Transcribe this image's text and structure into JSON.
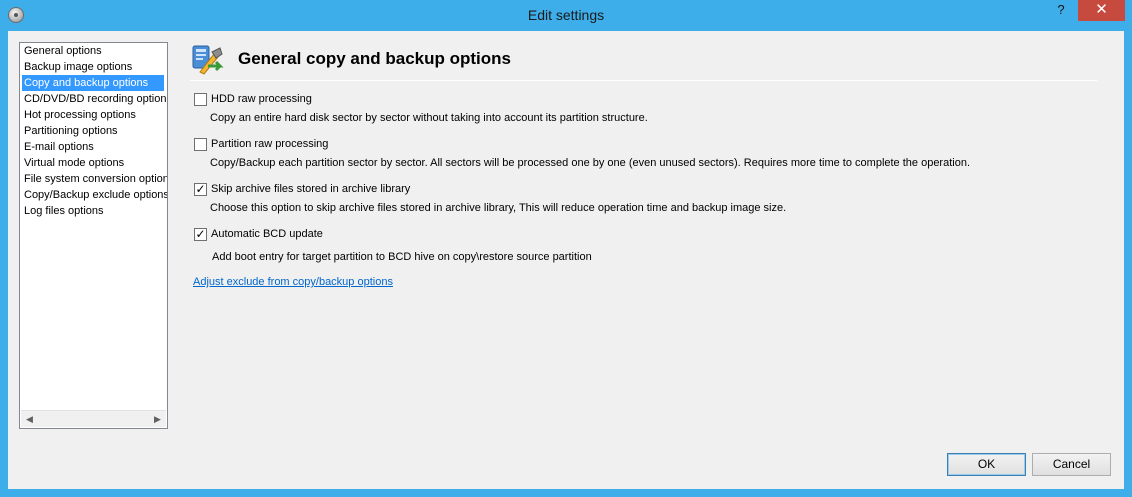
{
  "window": {
    "title": "Edit settings",
    "help_glyph": "?",
    "close_glyph": "✕"
  },
  "sidebar": {
    "selected_index": 2,
    "items": [
      {
        "label": "General options"
      },
      {
        "label": "Backup image options"
      },
      {
        "label": "Copy and backup options"
      },
      {
        "label": "CD/DVD/BD recording options"
      },
      {
        "label": "Hot processing options"
      },
      {
        "label": "Partitioning options"
      },
      {
        "label": "E-mail options"
      },
      {
        "label": "Virtual mode options"
      },
      {
        "label": "File system conversion options"
      },
      {
        "label": "Copy/Backup exclude options"
      },
      {
        "label": "Log files options"
      }
    ],
    "scroll_left_glyph": "◀",
    "scroll_right_glyph": "▶"
  },
  "panel": {
    "title": "General copy and backup options",
    "icon": "settings-tools-icon",
    "options": [
      {
        "label": "HDD raw processing",
        "checked": false,
        "description": "Copy an entire hard disk sector by sector without taking into account its partition structure."
      },
      {
        "label": "Partition raw processing",
        "checked": false,
        "description": "Copy/Backup each partition sector by sector. All sectors will be processed one by one (even unused sectors). Requires more time to complete the operation."
      },
      {
        "label": "Skip archive files stored in archive library",
        "checked": true,
        "description": "Choose this option to skip archive files stored in archive library, This will reduce operation time and backup image size."
      },
      {
        "label": "Automatic BCD update",
        "checked": true,
        "description": "Add boot entry for target partition to BCD hive on copy\\restore source partition"
      }
    ],
    "link_label": "Adjust exclude from copy/backup options"
  },
  "buttons": {
    "ok_label": "OK",
    "cancel_label": "Cancel"
  },
  "colors": {
    "titlebar": "#3daee9",
    "selection": "#3399ff",
    "close": "#c74a3f",
    "link": "#0066cc"
  }
}
